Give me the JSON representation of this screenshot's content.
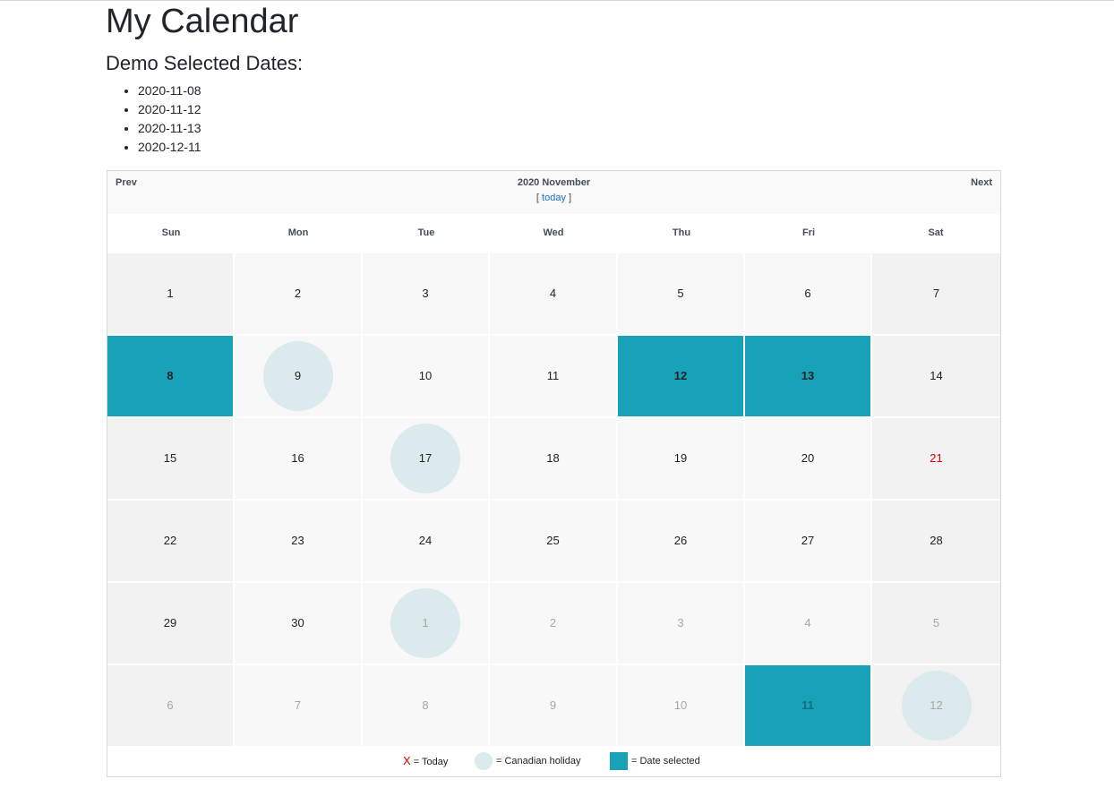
{
  "page": {
    "title": "My Calendar",
    "subtitle": "Demo Selected Dates:",
    "selected_dates": [
      "2020-11-08",
      "2020-11-12",
      "2020-11-13",
      "2020-12-11"
    ]
  },
  "calendar": {
    "prev_label": "Prev",
    "next_label": "Next",
    "month_title": "2020 November",
    "today_open": "[",
    "today_label": "today",
    "today_close": "]",
    "weekdays": [
      "Sun",
      "Mon",
      "Tue",
      "Wed",
      "Thu",
      "Fri",
      "Sat"
    ],
    "weeks": [
      [
        {
          "day": "1"
        },
        {
          "day": "2"
        },
        {
          "day": "3"
        },
        {
          "day": "4"
        },
        {
          "day": "5"
        },
        {
          "day": "6"
        },
        {
          "day": "7"
        }
      ],
      [
        {
          "day": "8",
          "selected": true
        },
        {
          "day": "9",
          "holiday": true
        },
        {
          "day": "10"
        },
        {
          "day": "11"
        },
        {
          "day": "12",
          "selected": true
        },
        {
          "day": "13",
          "selected": true
        },
        {
          "day": "14"
        }
      ],
      [
        {
          "day": "15"
        },
        {
          "day": "16"
        },
        {
          "day": "17",
          "holiday": true
        },
        {
          "day": "18"
        },
        {
          "day": "19"
        },
        {
          "day": "20"
        },
        {
          "day": "21",
          "today": true
        }
      ],
      [
        {
          "day": "22"
        },
        {
          "day": "23"
        },
        {
          "day": "24"
        },
        {
          "day": "25"
        },
        {
          "day": "26"
        },
        {
          "day": "27"
        },
        {
          "day": "28"
        }
      ],
      [
        {
          "day": "29"
        },
        {
          "day": "30"
        },
        {
          "day": "1",
          "other": true,
          "holiday": true
        },
        {
          "day": "2",
          "other": true
        },
        {
          "day": "3",
          "other": true
        },
        {
          "day": "4",
          "other": true
        },
        {
          "day": "5",
          "other": true
        }
      ],
      [
        {
          "day": "6",
          "other": true
        },
        {
          "day": "7",
          "other": true
        },
        {
          "day": "8",
          "other": true
        },
        {
          "day": "9",
          "other": true
        },
        {
          "day": "10",
          "other": true
        },
        {
          "day": "11",
          "other": true,
          "selected": true
        },
        {
          "day": "12",
          "other": true,
          "holiday": true
        }
      ]
    ],
    "legend": {
      "today_symbol": "X",
      "today_text": "= Today",
      "holiday_text": "= Canadian holiday",
      "selected_text": "= Date selected"
    },
    "colors": {
      "selected": "#17a2b8",
      "holiday": "#dbeaec",
      "today": "#e00000"
    }
  }
}
